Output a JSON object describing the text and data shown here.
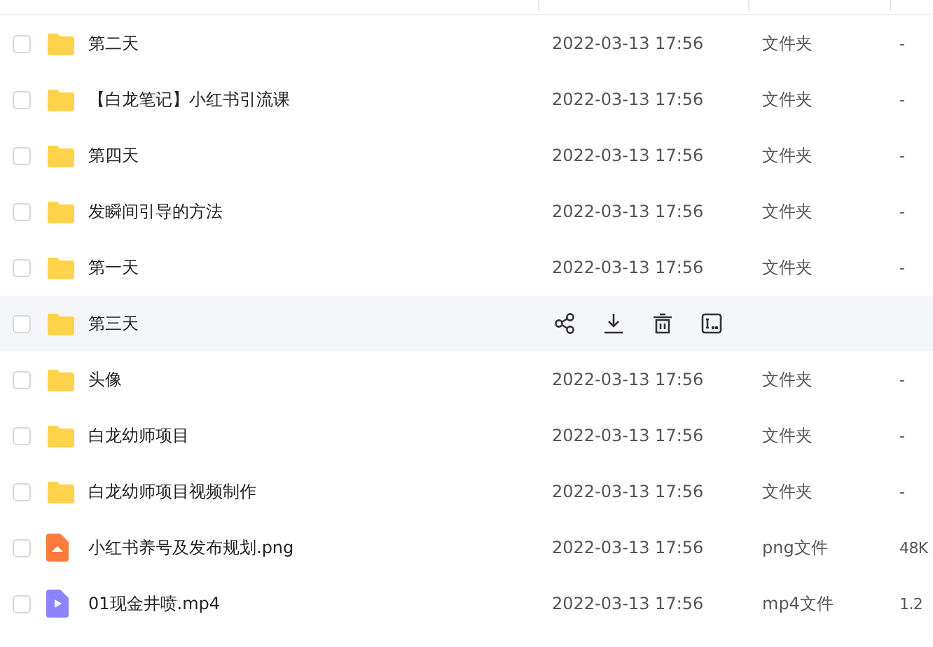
{
  "rows": [
    {
      "name": "第二天",
      "kind": "folder",
      "date": "2022-03-13 17:56",
      "type": "文件夹",
      "size": "-",
      "checked": false,
      "hovered": false
    },
    {
      "name": "【白龙笔记】小红书引流课",
      "kind": "folder",
      "date": "2022-03-13 17:56",
      "type": "文件夹",
      "size": "-",
      "checked": false,
      "hovered": false
    },
    {
      "name": "第四天",
      "kind": "folder",
      "date": "2022-03-13 17:56",
      "type": "文件夹",
      "size": "-",
      "checked": false,
      "hovered": false
    },
    {
      "name": "发瞬间引导的方法",
      "kind": "folder",
      "date": "2022-03-13 17:56",
      "type": "文件夹",
      "size": "-",
      "checked": false,
      "hovered": false
    },
    {
      "name": "第一天",
      "kind": "folder",
      "date": "2022-03-13 17:56",
      "type": "文件夹",
      "size": "-",
      "checked": false,
      "hovered": false
    },
    {
      "name": "第三天",
      "kind": "folder",
      "checked": false,
      "hovered": true
    },
    {
      "name": "头像",
      "kind": "folder",
      "date": "2022-03-13 17:56",
      "type": "文件夹",
      "size": "-",
      "checked": false,
      "hovered": false
    },
    {
      "name": "白龙幼师项目",
      "kind": "folder",
      "date": "2022-03-13 17:56",
      "type": "文件夹",
      "size": "-",
      "checked": false,
      "hovered": false
    },
    {
      "name": "白龙幼师项目视频制作",
      "kind": "folder",
      "date": "2022-03-13 17:56",
      "type": "文件夹",
      "size": "-",
      "checked": false,
      "hovered": false
    },
    {
      "name": "小红书养号及发布规划.png",
      "kind": "image",
      "date": "2022-03-13 17:56",
      "type": "png文件",
      "size": "48K",
      "checked": false,
      "hovered": false
    },
    {
      "name": "01现金井喷.mp4",
      "kind": "video",
      "date": "2022-03-13 17:56",
      "type": "mp4文件",
      "size": "1.2",
      "checked": false,
      "hovered": false
    }
  ]
}
